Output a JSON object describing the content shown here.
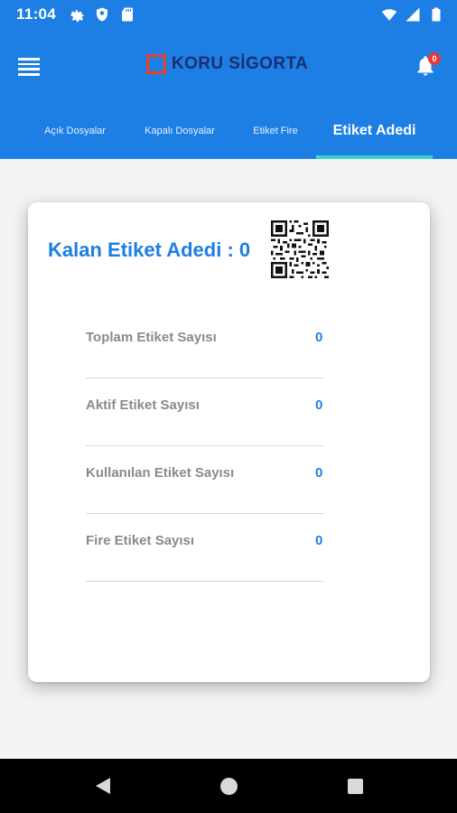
{
  "status_bar": {
    "time": "11:04",
    "left_icons": [
      "gear-icon",
      "shield-icon",
      "sd-card-icon"
    ],
    "right_icons": [
      "wifi-icon",
      "signal-icon",
      "battery-icon"
    ]
  },
  "header": {
    "menu_icon": "menu-icon",
    "logo_text": "KORU SİGORTA",
    "notification_count": "0",
    "colors": {
      "appbar": "#1d7fe4",
      "logo_red": "#e8402a",
      "logo_navy": "#1b2e74",
      "indicator": "#3cd3c9"
    }
  },
  "tabs": [
    {
      "label": "Açık Dosyalar",
      "active": false
    },
    {
      "label": "Kapalı Dosyalar",
      "active": false
    },
    {
      "label": "Etiket Fire",
      "active": false
    },
    {
      "label": "Etiket Adedi",
      "active": true
    }
  ],
  "card": {
    "title": "Kalan Etiket Adedi : 0",
    "qr_icon": "qr-code-icon",
    "rows": [
      {
        "label": "Toplam Etiket Sayısı",
        "value": "0"
      },
      {
        "label": "Aktif Etiket Sayısı",
        "value": "0"
      },
      {
        "label": "Kullanılan Etiket Sayısı",
        "value": "0"
      },
      {
        "label": "Fire Etiket Sayısı",
        "value": "0"
      }
    ]
  },
  "nav_bar": {
    "back_icon": "back-triangle-icon",
    "home_icon": "home-circle-icon",
    "recents_icon": "recents-square-icon"
  }
}
